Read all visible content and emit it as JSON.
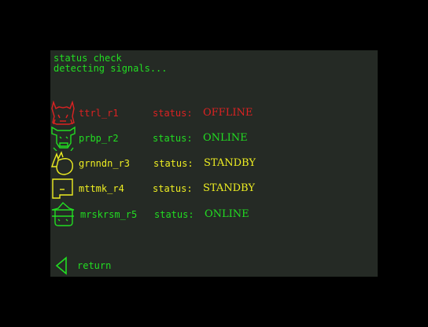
{
  "header": {
    "line1": "status check",
    "line2": "detecting signals..."
  },
  "colors": {
    "green": "#22dd22",
    "red": "#dd2222",
    "yellow": "#eeee22",
    "panel_bg": "#252a25"
  },
  "units": [
    {
      "icon": "demon-icon",
      "name": "ttrl_r1",
      "status_label": "status:",
      "status": "OFFLINE",
      "color": "red"
    },
    {
      "icon": "horned-beast-icon",
      "name": "prbp_r2",
      "status_label": "status:",
      "status": "ONLINE",
      "color": "green"
    },
    {
      "icon": "crested-creature-icon",
      "name": "grnndn_r3",
      "status_label": "status:",
      "status": "STANDBY",
      "color": "yellow"
    },
    {
      "icon": "box-face-icon",
      "name": "mttmk_r4",
      "status_label": "status:",
      "status": "STANDBY",
      "color": "yellow"
    },
    {
      "icon": "witch-hat-icon",
      "name": "mrskrsm_r5",
      "status_label": "status:",
      "status": "ONLINE",
      "color": "green"
    }
  ],
  "footer": {
    "return_label": "return",
    "return_icon": "back-arrow-icon"
  }
}
